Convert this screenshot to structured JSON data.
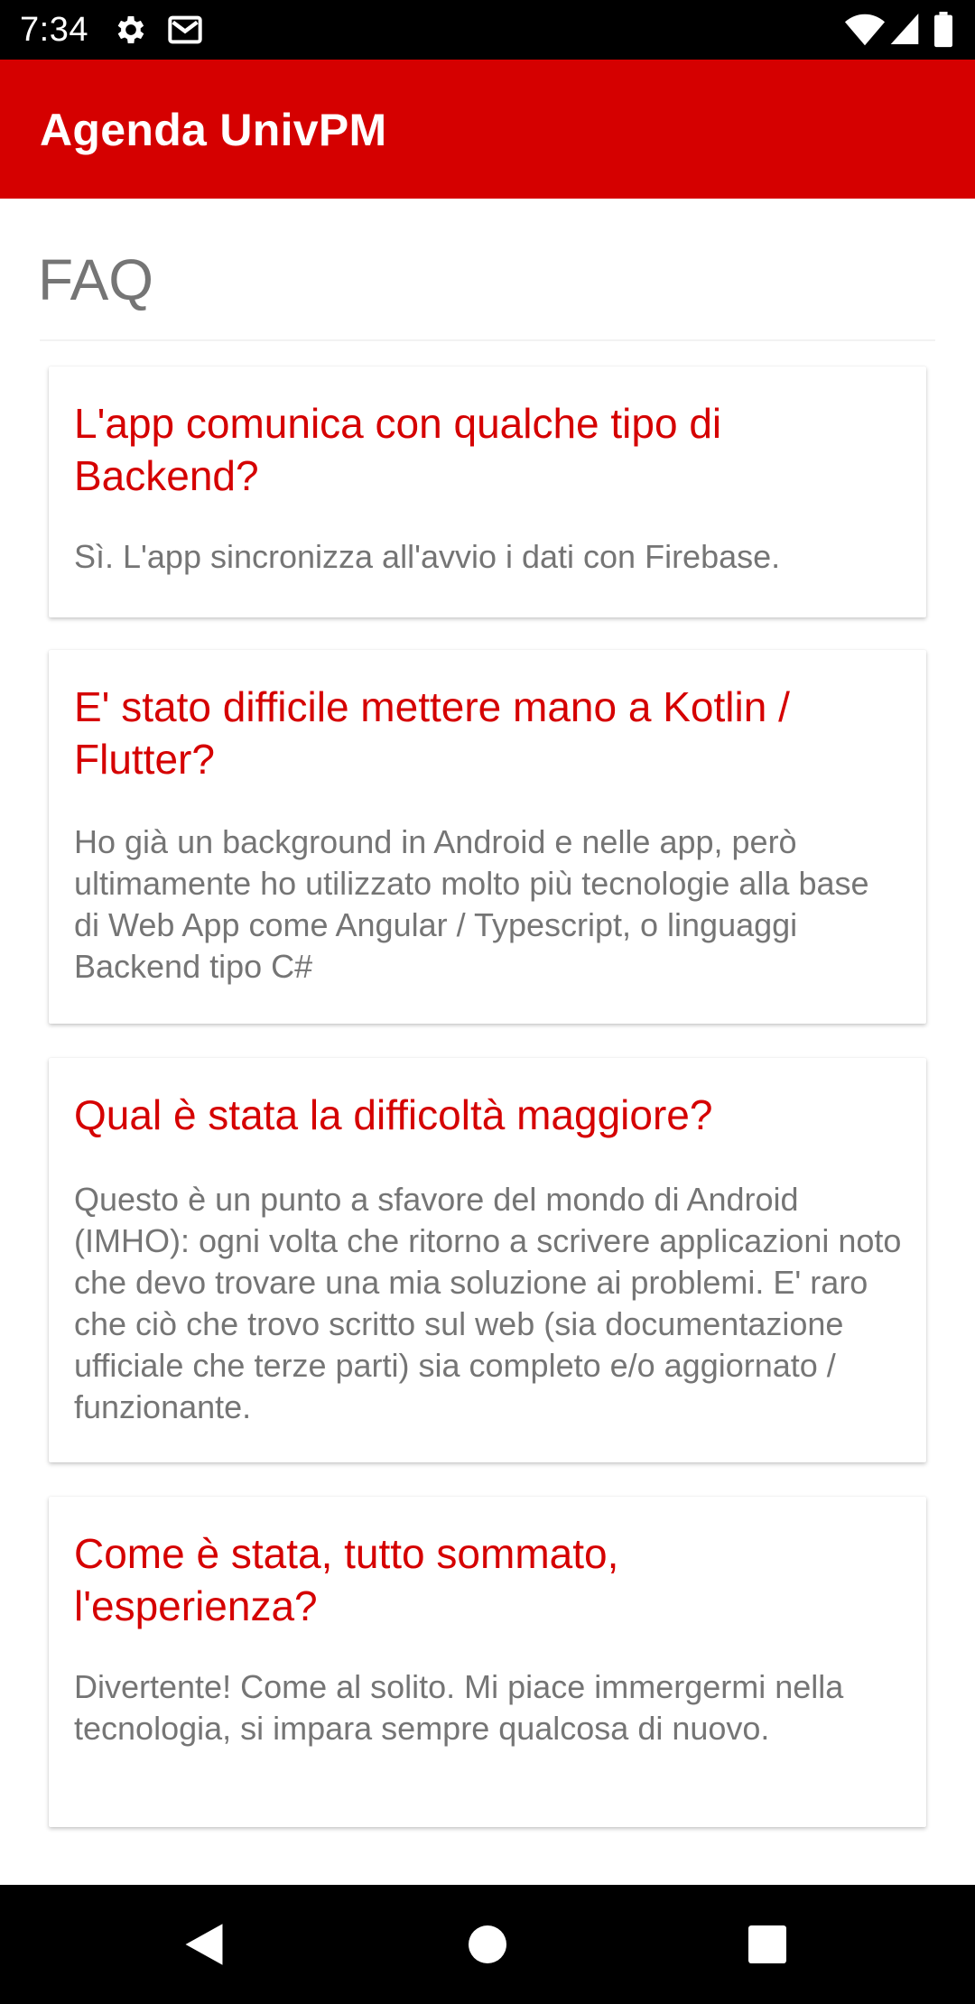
{
  "status_bar": {
    "time": "7:34",
    "icons": [
      "gear-icon",
      "gmail-icon",
      "wifi-icon",
      "signal-icon",
      "battery-icon"
    ]
  },
  "app_bar": {
    "title": "Agenda UnivPM",
    "color": "#d50000"
  },
  "page": {
    "title": "FAQ"
  },
  "faq": [
    {
      "question": "L'app comunica con qualche tipo di Backend?",
      "answer": "Sì. L'app sincronizza all'avvio i dati con Firebase."
    },
    {
      "question": "E' stato difficile mettere mano a Kotlin / Flutter?",
      "answer": "Ho già un background in Android e nelle app, però ultimamente ho utilizzato molto più tecnologie alla base di Web App come Angular / Typescript, o linguaggi Backend tipo C#"
    },
    {
      "question": "Qual è stata la difficoltà maggiore?",
      "answer": "Questo è un punto a sfavore del mondo di Android (IMHO): ogni volta che ritorno a scrivere applicazioni noto che devo trovare una mia soluzione ai problemi. E' raro che ciò che trovo scritto sul web (sia documentazione ufficiale che terze parti) sia completo e/o aggiornato / funzionante."
    },
    {
      "question": "Come è stata, tutto sommato, l'esperienza?",
      "answer": "Divertente! Come al solito. Mi piace immergermi nella tecnologia, si impara sempre qualcosa di nuovo."
    }
  ],
  "nav_bar": {
    "icons": [
      "back-icon",
      "home-icon",
      "recents-icon"
    ]
  }
}
